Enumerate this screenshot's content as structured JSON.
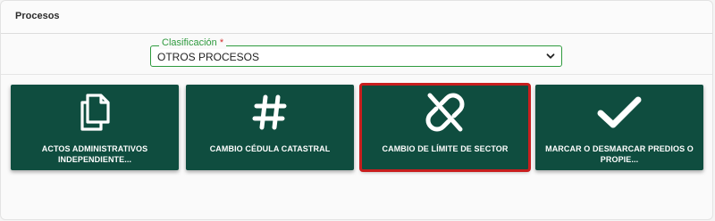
{
  "panel": {
    "title": "Procesos"
  },
  "classification": {
    "label": "Clasificación",
    "required_mark": "*",
    "value": "OTROS PROCESOS"
  },
  "cards": [
    {
      "label": "ACTOS ADMINISTRATIVOS INDEPENDIENTE...",
      "icon": "copy-icon",
      "selected": false
    },
    {
      "label": "CAMBIO CÉDULA CATASTRAL",
      "icon": "hashtag-icon",
      "selected": false
    },
    {
      "label": "CAMBIO DE LÍMITE DE SECTOR",
      "icon": "unlink-icon",
      "selected": true
    },
    {
      "label": "MARCAR O DESMARCAR PREDIOS O PROPIE...",
      "icon": "checkmark-icon",
      "selected": false
    }
  ],
  "colors": {
    "card_background": "#0f4d3f",
    "accent_green": "#2e9a3e",
    "selected_outline": "#c81e1e",
    "required_red": "#d32f2f"
  }
}
